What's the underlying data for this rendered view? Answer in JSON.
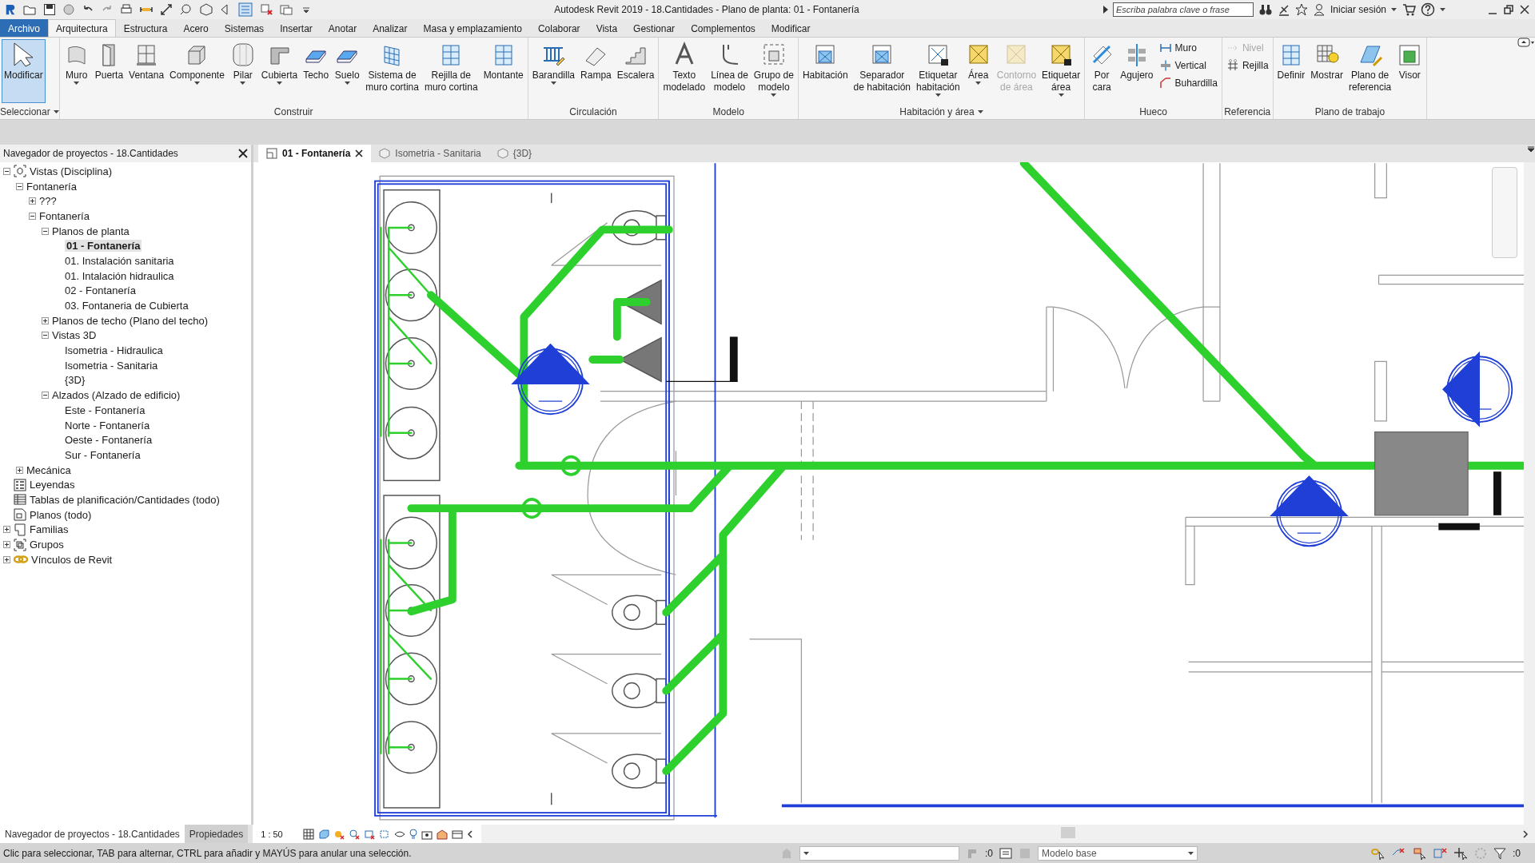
{
  "title_bar": {
    "title": "Autodesk Revit 2019 - 18.Cantidades - Plano de planta: 01 - Fontanería",
    "search": {
      "placeholder": "Escriba palabra clave o frase"
    },
    "sign_in": "Iniciar sesión"
  },
  "ribbon_tabs": [
    {
      "label": "Archivo",
      "kind": "file",
      "selected": false
    },
    {
      "label": "Arquitectura",
      "kind": "tab",
      "selected": true
    },
    {
      "label": "Estructura",
      "kind": "tab",
      "selected": false
    },
    {
      "label": "Acero",
      "kind": "tab",
      "selected": false
    },
    {
      "label": "Sistemas",
      "kind": "tab",
      "selected": false
    },
    {
      "label": "Insertar",
      "kind": "tab",
      "selected": false
    },
    {
      "label": "Anotar",
      "kind": "tab",
      "selected": false
    },
    {
      "label": "Analizar",
      "kind": "tab",
      "selected": false
    },
    {
      "label": "Masa y emplazamiento",
      "kind": "tab",
      "selected": false
    },
    {
      "label": "Colaborar",
      "kind": "tab",
      "selected": false
    },
    {
      "label": "Vista",
      "kind": "tab",
      "selected": false
    },
    {
      "label": "Gestionar",
      "kind": "tab",
      "selected": false
    },
    {
      "label": "Complementos",
      "kind": "tab",
      "selected": false
    },
    {
      "label": "Modificar",
      "kind": "tab",
      "selected": false
    }
  ],
  "ribbon_panels": [
    {
      "title": "Seleccionar",
      "has_menu": true,
      "tools": [
        {
          "label": "Modificar",
          "kind": "large",
          "selected": true,
          "dropdown": false,
          "disabled": false
        }
      ]
    },
    {
      "title": "Construir",
      "has_menu": false,
      "tools": [
        {
          "label": "Muro",
          "kind": "large",
          "selected": false,
          "dropdown": true,
          "disabled": false
        },
        {
          "label": "Puerta",
          "kind": "large",
          "selected": false,
          "dropdown": false,
          "disabled": false
        },
        {
          "label": "Ventana",
          "kind": "large",
          "selected": false,
          "dropdown": false,
          "disabled": false
        },
        {
          "label": "Componente",
          "kind": "large",
          "selected": false,
          "dropdown": true,
          "disabled": false
        },
        {
          "label": "Pilar",
          "kind": "large",
          "selected": false,
          "dropdown": true,
          "disabled": false
        },
        {
          "label": "Cubierta",
          "kind": "large",
          "selected": false,
          "dropdown": true,
          "disabled": false
        },
        {
          "label": "Techo",
          "kind": "large",
          "selected": false,
          "dropdown": false,
          "disabled": false
        },
        {
          "label": "Suelo",
          "kind": "large",
          "selected": false,
          "dropdown": true,
          "disabled": false
        },
        {
          "label": "Sistema de\nmuro cortina",
          "kind": "large",
          "selected": false,
          "dropdown": false,
          "disabled": false
        },
        {
          "label": "Rejilla de\nmuro cortina",
          "kind": "large",
          "selected": false,
          "dropdown": false,
          "disabled": false
        },
        {
          "label": "Montante",
          "kind": "large",
          "selected": false,
          "dropdown": false,
          "disabled": false
        }
      ]
    },
    {
      "title": "Circulación",
      "has_menu": false,
      "tools": [
        {
          "label": "Barandilla",
          "kind": "large",
          "selected": false,
          "dropdown": true,
          "disabled": false
        },
        {
          "label": "Rampa",
          "kind": "large",
          "selected": false,
          "dropdown": false,
          "disabled": false
        },
        {
          "label": "Escalera",
          "kind": "large",
          "selected": false,
          "dropdown": false,
          "disabled": false
        }
      ]
    },
    {
      "title": "Modelo",
      "has_menu": false,
      "tools": [
        {
          "label": "Texto\nmodelado",
          "kind": "large",
          "selected": false,
          "dropdown": false,
          "disabled": false
        },
        {
          "label": "Línea de\nmodelo",
          "kind": "large",
          "selected": false,
          "dropdown": false,
          "disabled": false
        },
        {
          "label": "Grupo de\nmodelo",
          "kind": "large",
          "selected": false,
          "dropdown": true,
          "disabled": false
        }
      ]
    },
    {
      "title": "Habitación y área",
      "has_menu": true,
      "tools": [
        {
          "label": "Habitación",
          "kind": "large",
          "selected": false,
          "dropdown": false,
          "disabled": false
        },
        {
          "label": "Separador\nde habitación",
          "kind": "large",
          "selected": false,
          "dropdown": false,
          "disabled": false
        },
        {
          "label": "Etiquetar\nhabitación",
          "kind": "large",
          "selected": false,
          "dropdown": true,
          "disabled": false
        },
        {
          "label": "Área",
          "kind": "large",
          "selected": false,
          "dropdown": true,
          "disabled": false
        },
        {
          "label": "Contorno\nde área",
          "kind": "large",
          "selected": false,
          "dropdown": false,
          "disabled": true
        },
        {
          "label": "Etiquetar\nárea",
          "kind": "large",
          "selected": false,
          "dropdown": true,
          "disabled": false
        }
      ]
    },
    {
      "title": "Hueco",
      "has_menu": false,
      "tools": [
        {
          "label": "Por\ncara",
          "kind": "large",
          "selected": false,
          "dropdown": false,
          "disabled": false
        },
        {
          "label": "Agujero",
          "kind": "large",
          "selected": false,
          "dropdown": false,
          "disabled": false
        },
        {
          "label": "Muro",
          "kind": "small",
          "selected": false,
          "dropdown": false,
          "disabled": false
        },
        {
          "label": "Vertical",
          "kind": "small",
          "selected": false,
          "dropdown": false,
          "disabled": false
        },
        {
          "label": "Buhardilla",
          "kind": "small",
          "selected": false,
          "dropdown": false,
          "disabled": false
        }
      ]
    },
    {
      "title": "Referencia",
      "has_menu": false,
      "tools": [
        {
          "label": "Nivel",
          "kind": "small",
          "selected": false,
          "dropdown": false,
          "disabled": true
        },
        {
          "label": "Rejilla",
          "kind": "small",
          "selected": false,
          "dropdown": false,
          "disabled": false
        }
      ]
    },
    {
      "title": "Plano de trabajo",
      "has_menu": false,
      "tools": [
        {
          "label": "Definir",
          "kind": "large",
          "selected": false,
          "dropdown": false,
          "disabled": false
        },
        {
          "label": "Mostrar",
          "kind": "large",
          "selected": false,
          "dropdown": false,
          "disabled": false
        },
        {
          "label": "Plano de\nreferencia",
          "kind": "large",
          "selected": false,
          "dropdown": false,
          "disabled": false
        },
        {
          "label": "Visor",
          "kind": "large",
          "selected": false,
          "dropdown": false,
          "disabled": false
        }
      ]
    }
  ],
  "project_browser": {
    "title": "Navegador de proyectos - 18.Cantidades",
    "tree": [
      {
        "label": "Vistas (Disciplina)",
        "kind": "views",
        "expanded": true,
        "selected": false,
        "children": [
          {
            "label": "Fontanería",
            "expanded": true,
            "selected": false,
            "children": [
              {
                "label": "???",
                "expanded": false,
                "selected": false
              },
              {
                "label": "Fontanería",
                "expanded": true,
                "selected": false,
                "children": [
                  {
                    "label": "Planos de planta",
                    "expanded": true,
                    "selected": false,
                    "children": [
                      {
                        "label": "01 - Fontanería",
                        "selected": true
                      },
                      {
                        "label": "01. Instalación sanitaria",
                        "selected": false
                      },
                      {
                        "label": "01. Intalación hidraulica",
                        "selected": false
                      },
                      {
                        "label": "02 - Fontanería",
                        "selected": false
                      },
                      {
                        "label": "03. Fontaneria de Cubierta",
                        "selected": false
                      }
                    ]
                  },
                  {
                    "label": "Planos de techo (Plano del techo)",
                    "expanded": false,
                    "selected": false
                  },
                  {
                    "label": "Vistas 3D",
                    "expanded": true,
                    "selected": false,
                    "children": [
                      {
                        "label": "Isometria - Hidraulica",
                        "selected": false
                      },
                      {
                        "label": "Isometria - Sanitaria",
                        "selected": false
                      },
                      {
                        "label": "{3D}",
                        "selected": false
                      }
                    ]
                  },
                  {
                    "label": "Alzados (Alzado de edificio)",
                    "expanded": true,
                    "selected": false,
                    "children": [
                      {
                        "label": "Este - Fontanería",
                        "selected": false
                      },
                      {
                        "label": "Norte - Fontanería",
                        "selected": false
                      },
                      {
                        "label": "Oeste - Fontanería",
                        "selected": false
                      },
                      {
                        "label": "Sur - Fontanería",
                        "selected": false
                      }
                    ]
                  }
                ]
              }
            ]
          },
          {
            "label": "Mecánica",
            "expanded": false,
            "selected": false
          }
        ]
      },
      {
        "label": "Leyendas",
        "kind": "legends",
        "selected": false
      },
      {
        "label": "Tablas de planificación/Cantidades (todo)",
        "kind": "schedules",
        "selected": false
      },
      {
        "label": "Planos (todo)",
        "kind": "sheets",
        "selected": false
      },
      {
        "label": "Familias",
        "kind": "families",
        "expanded": false,
        "selected": false
      },
      {
        "label": "Grupos",
        "kind": "groups",
        "expanded": false,
        "selected": false
      },
      {
        "label": "Vínculos de Revit",
        "kind": "links",
        "expanded": false,
        "selected": false
      }
    ]
  },
  "view_tabs": [
    {
      "label": "01 - Fontanería",
      "selected": true
    },
    {
      "label": "Isometria - Sanitaria",
      "selected": false
    },
    {
      "label": "{3D}",
      "selected": false
    }
  ],
  "bottom_tabs": [
    {
      "label": "Navegador de proyectos - 18.Cantidades",
      "selected": true
    },
    {
      "label": "Propiedades",
      "selected": false
    }
  ],
  "view_control": {
    "scale": "1 : 50"
  },
  "status_bar": {
    "message": "Clic para seleccionar, TAB para alternar, CTRL para añadir y MAYÚS para anular una selección.",
    "editable_count": ":0",
    "model": "Modelo base",
    "filter_count": ":0"
  }
}
